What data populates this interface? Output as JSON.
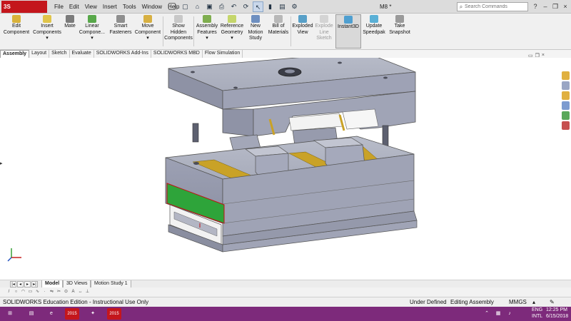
{
  "app": {
    "logo_text": "3S SOLIDWORKS",
    "doc_title": "M8 *",
    "menus": [
      "File",
      "Edit",
      "View",
      "Insert",
      "Tools",
      "Window",
      "Help"
    ]
  },
  "search": {
    "placeholder": "Search Commands"
  },
  "ribbon": {
    "buttons": [
      {
        "label1": "Edit",
        "label2": "Component",
        "label3": ""
      },
      {
        "label1": "Insert",
        "label2": "Components",
        "label3": ""
      },
      {
        "label1": "Mate",
        "label2": "",
        "label3": ""
      },
      {
        "label1": "Linear",
        "label2": "Compone...",
        "label3": ""
      },
      {
        "label1": "Smart",
        "label2": "Fasteners",
        "label3": ""
      },
      {
        "label1": "Move",
        "label2": "Component",
        "label3": ""
      },
      {
        "label1": "Show",
        "label2": "Hidden",
        "label3": "Components"
      },
      {
        "label1": "Assembly",
        "label2": "Features",
        "label3": ""
      },
      {
        "label1": "Reference",
        "label2": "Geometry",
        "label3": ""
      },
      {
        "label1": "New",
        "label2": "Motion",
        "label3": "Study"
      },
      {
        "label1": "Bill of",
        "label2": "Materials",
        "label3": ""
      },
      {
        "label1": "Exploded",
        "label2": "View",
        "label3": ""
      },
      {
        "label1": "Explode",
        "label2": "Line",
        "label3": "Sketch"
      },
      {
        "label1": "Instant3D",
        "label2": "",
        "label3": ""
      },
      {
        "label1": "Update",
        "label2": "Speedpak",
        "label3": ""
      },
      {
        "label1": "Take",
        "label2": "Snapshot",
        "label3": ""
      }
    ]
  },
  "tabs": [
    "Assembly",
    "Layout",
    "Sketch",
    "Evaluate",
    "SOLIDWORKS Add-Ins",
    "SOLIDWORKS MBD",
    "Flow Simulation"
  ],
  "model_tabs": [
    "Model",
    "3D Views",
    "Motion Study 1"
  ],
  "status": {
    "edition": "SOLIDWORKS Education Edition - Instructional Use Only",
    "state": "Under Defined",
    "mode": "Editing Assembly",
    "units": "MMGS"
  },
  "taskbar": {
    "lang1": "ENG",
    "lang2": "INTL",
    "time": "12:25 PM",
    "date": "6/15/2018",
    "sw_badge": "2015"
  },
  "colors": {
    "brand_red": "#c4161c",
    "taskbar_purple": "#7d2a7b",
    "mold_gray": "#9da1b4",
    "accent_green": "#2ea43a",
    "gold_rail": "#c9a227"
  }
}
